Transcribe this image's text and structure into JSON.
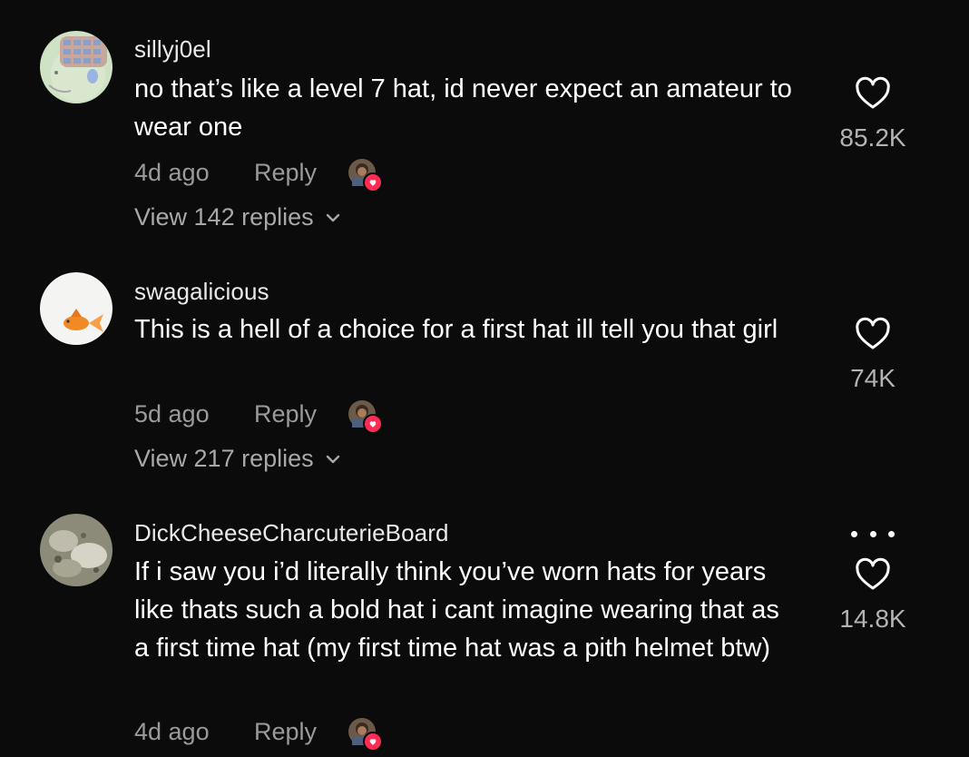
{
  "comments": [
    {
      "username": "sillyj0el",
      "text": "no that’s like a level 7 hat, id never expect an amateur to wear one",
      "time": "4d ago",
      "reply_label": "Reply",
      "view_replies": "View 142 replies",
      "likes": "85.2K",
      "avatar_icon": "cartoon-face-avatar"
    },
    {
      "username": "swagalicious",
      "text": "This is a hell of a choice for a first hat ill tell you that girl",
      "time": "5d ago",
      "reply_label": "Reply",
      "view_replies": "View 217 replies",
      "likes": "74K",
      "avatar_icon": "goldfish-avatar"
    },
    {
      "username": "DickCheeseCharcuterieBoard",
      "text": "If i saw you i’d literally think you’ve worn hats for years like thats such a bold hat i cant imagine wearing that as a first time hat (my first time hat was a pith helmet btw)",
      "time": "4d ago",
      "reply_label": "Reply",
      "likes": "14.8K",
      "avatar_icon": "photo-avatar"
    }
  ],
  "colors": {
    "background": "#0b0b0b",
    "muted_text": "#9a9a9a",
    "like_badge": "#fe2c55"
  }
}
